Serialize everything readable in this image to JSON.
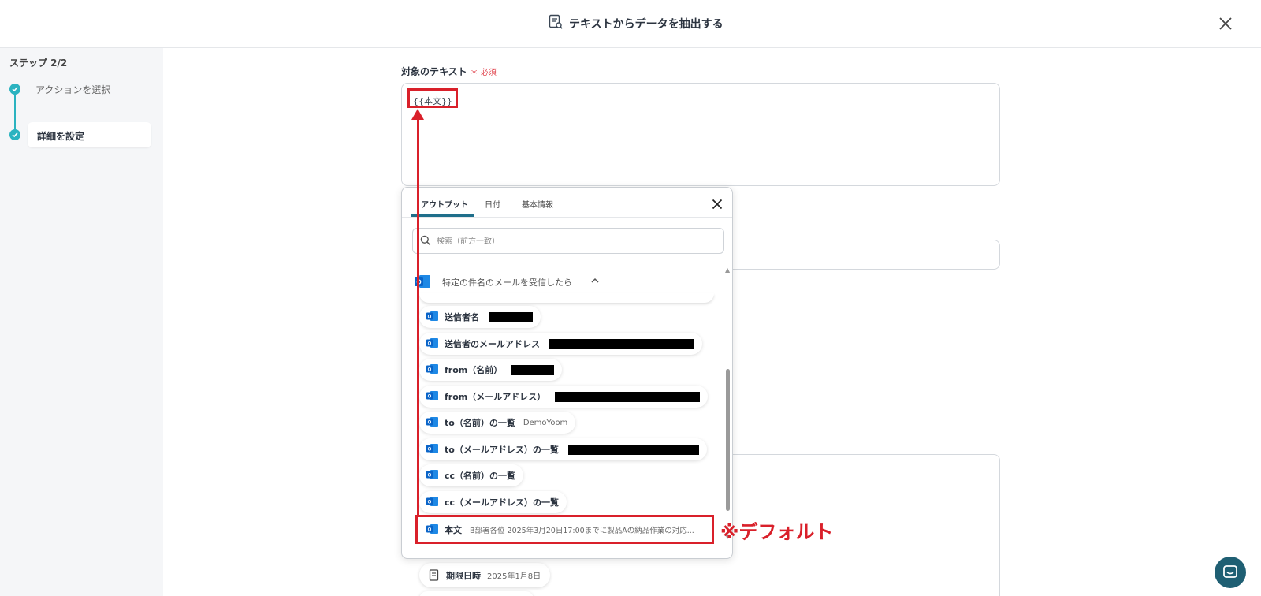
{
  "header": {
    "title": "テキストからデータを抽出する"
  },
  "sidebar": {
    "step_count": "ステップ 2/2",
    "steps": [
      {
        "label": "アクションを選択"
      },
      {
        "label": "詳細を設定"
      }
    ]
  },
  "form": {
    "field_label": "対象のテキスト",
    "required_label": "＊ 必須",
    "variable_chip": "{{本文}}"
  },
  "dropdown": {
    "tabs": [
      {
        "label": "アウトプット"
      },
      {
        "label": "日付"
      },
      {
        "label": "基本情報"
      }
    ],
    "search_placeholder": "検索（前方一致）",
    "group_title": "特定の件名のメールを受信したら",
    "items": [
      {
        "label": "送信者名",
        "value": ""
      },
      {
        "label": "送信者のメールアドレス",
        "value": ""
      },
      {
        "label": "from（名前）",
        "value": ""
      },
      {
        "label": "from（メールアドレス）",
        "value": ""
      },
      {
        "label": "to（名前）の一覧",
        "value": "DemoYoom"
      },
      {
        "label": "to（メールアドレス）の一覧",
        "value": ""
      },
      {
        "label": "cc（名前）の一覧",
        "value": ""
      },
      {
        "label": "cc（メールアドレス）の一覧",
        "value": ""
      },
      {
        "label": "本文",
        "value": "B部署各位 2025年3月20日17:00までに製品Aの納品作業の対応..."
      }
    ]
  },
  "below": {
    "chip_label": "期限日時",
    "chip_value": "2025年1月8日"
  },
  "annotation": {
    "text": "※デフォルト"
  },
  "colors": {
    "accent": "#2bb3c0",
    "highlight": "#d9202a",
    "outlook": "#0a64c8"
  }
}
